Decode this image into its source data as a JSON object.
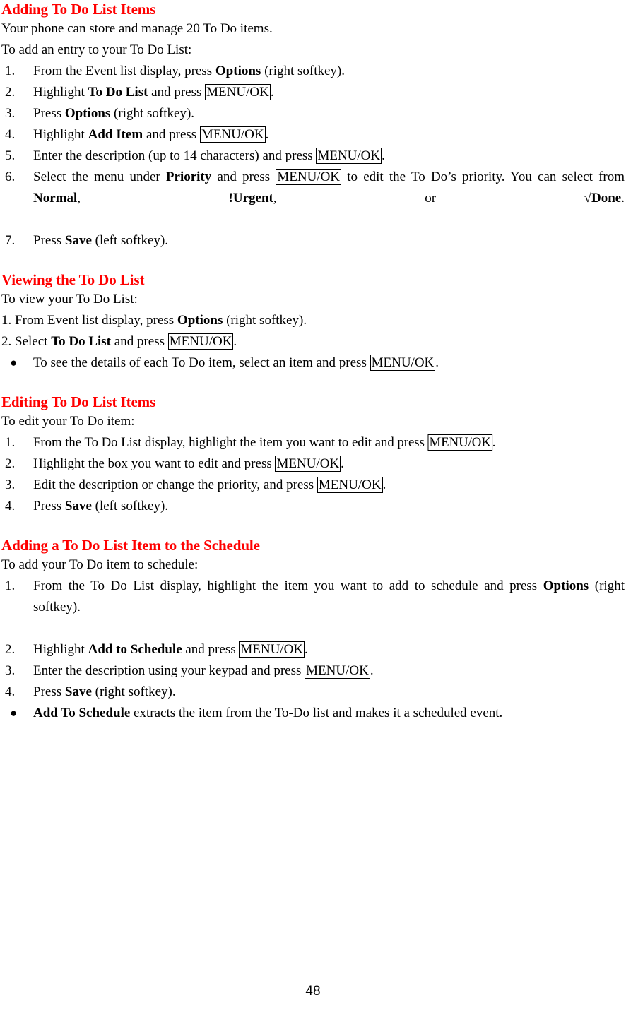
{
  "document": {
    "page_number": "48",
    "heading_color": "#ff0000",
    "text_color": "#000000"
  },
  "sections": [
    {
      "id": "adding",
      "heading": "Adding To Do List Items",
      "intro_1": "Your phone can store and manage 20 To Do items.",
      "intro_2": "To add an entry to your To Do List:",
      "steps": [
        {
          "num": "1.",
          "parts": [
            {
              "t": "From the Event list display, press ",
              "s": "plain"
            },
            {
              "t": "Options",
              "s": "bold"
            },
            {
              "t": " (right softkey).",
              "s": "plain"
            }
          ]
        },
        {
          "num": "2.",
          "parts": [
            {
              "t": "Highlight ",
              "s": "plain"
            },
            {
              "t": "To Do List",
              "s": "bold"
            },
            {
              "t": " and press ",
              "s": "plain"
            },
            {
              "t": "MENU/OK",
              "s": "key"
            },
            {
              "t": ".",
              "s": "plain"
            }
          ]
        },
        {
          "num": "3.",
          "parts": [
            {
              "t": "Press ",
              "s": "plain"
            },
            {
              "t": "Options",
              "s": "bold"
            },
            {
              "t": " (right softkey).",
              "s": "plain"
            }
          ]
        },
        {
          "num": "4.",
          "parts": [
            {
              "t": "Highlight ",
              "s": "plain"
            },
            {
              "t": "Add Item",
              "s": "bold"
            },
            {
              "t": " and press ",
              "s": "plain"
            },
            {
              "t": "MENU/OK",
              "s": "key"
            },
            {
              "t": ".",
              "s": "plain"
            }
          ]
        },
        {
          "num": "5.",
          "parts": [
            {
              "t": "Enter the description (up to 14 characters) and press ",
              "s": "plain"
            },
            {
              "t": "MENU/OK",
              "s": "key"
            },
            {
              "t": ".",
              "s": "plain"
            }
          ]
        },
        {
          "num": "6.",
          "justify": true,
          "parts": [
            {
              "t": "Select the menu under ",
              "s": "plain"
            },
            {
              "t": "Priority",
              "s": "bold"
            },
            {
              "t": " and press ",
              "s": "plain"
            },
            {
              "t": "MENU/OK",
              "s": "key"
            },
            {
              "t": " to edit the To Do’s priority. You can select from ",
              "s": "plain"
            },
            {
              "t": "Normal",
              "s": "bold"
            },
            {
              "t": ", ",
              "s": "plain"
            },
            {
              "t": "!Urgent",
              "s": "bold"
            },
            {
              "t": ", or ",
              "s": "plain"
            },
            {
              "t": "√Done",
              "s": "bold"
            },
            {
              "t": ".",
              "s": "plain"
            }
          ]
        },
        {
          "num": "7.",
          "parts": [
            {
              "t": "Press ",
              "s": "plain"
            },
            {
              "t": "Save",
              "s": "bold"
            },
            {
              "t": " (left softkey).",
              "s": "plain"
            }
          ]
        }
      ]
    },
    {
      "id": "viewing",
      "heading": "Viewing the To Do List",
      "intro_1": "To view your To Do List:",
      "plain_steps": [
        {
          "parts": [
            {
              "t": "1. From Event list display, press ",
              "s": "plain"
            },
            {
              "t": "Options",
              "s": "bold"
            },
            {
              "t": " (right softkey).",
              "s": "plain"
            }
          ]
        },
        {
          "parts": [
            {
              "t": "2. Select ",
              "s": "plain"
            },
            {
              "t": "To Do List",
              "s": "bold"
            },
            {
              "t": " and press ",
              "s": "plain"
            },
            {
              "t": "MENU/OK",
              "s": "key"
            },
            {
              "t": ".",
              "s": "plain"
            }
          ]
        }
      ],
      "bullets": [
        {
          "marker": "●",
          "parts": [
            {
              "t": "To see the details of each To Do item, select an item and press ",
              "s": "plain"
            },
            {
              "t": "MENU/OK",
              "s": "key"
            },
            {
              "t": ".",
              "s": "plain"
            }
          ]
        }
      ]
    },
    {
      "id": "editing",
      "heading": "Editing To Do List Items",
      "intro_1": "To edit your To Do item:",
      "steps": [
        {
          "num": "1.",
          "tight": true,
          "parts": [
            {
              "t": "From the To Do List display, highlight the item you want to edit and press ",
              "s": "plain"
            },
            {
              "t": "MENU/OK",
              "s": "key"
            },
            {
              "t": ".",
              "s": "plain"
            }
          ]
        },
        {
          "num": "2.",
          "parts": [
            {
              "t": "Highlight the box you want to edit and press ",
              "s": "plain"
            },
            {
              "t": "MENU/OK",
              "s": "key"
            },
            {
              "t": ".",
              "s": "plain"
            }
          ]
        },
        {
          "num": "3.",
          "parts": [
            {
              "t": "Edit the description or change the priority, and press ",
              "s": "plain"
            },
            {
              "t": "MENU/OK",
              "s": "key"
            },
            {
              "t": ".",
              "s": "plain"
            }
          ]
        },
        {
          "num": "4.",
          "parts": [
            {
              "t": "Press ",
              "s": "plain"
            },
            {
              "t": "Save",
              "s": "bold"
            },
            {
              "t": " (left softkey).",
              "s": "plain"
            }
          ]
        }
      ]
    },
    {
      "id": "schedule",
      "heading": "Adding a To Do List Item to the Schedule",
      "intro_1": "To add your To Do item to schedule:",
      "steps": [
        {
          "num": "1.",
          "justify": true,
          "parts": [
            {
              "t": "From the To Do List display, highlight the item you want to add to schedule and press ",
              "s": "plain"
            },
            {
              "t": "Options",
              "s": "bold"
            },
            {
              "t": " (right softkey).",
              "s": "plain"
            }
          ]
        },
        {
          "num": "2.",
          "parts": [
            {
              "t": "Highlight ",
              "s": "plain"
            },
            {
              "t": "Add to Schedule",
              "s": "bold"
            },
            {
              "t": " and press ",
              "s": "plain"
            },
            {
              "t": "MENU/OK",
              "s": "key"
            },
            {
              "t": ".",
              "s": "plain"
            }
          ]
        },
        {
          "num": "3.",
          "parts": [
            {
              "t": "Enter the description using your keypad and press ",
              "s": "plain"
            },
            {
              "t": "MENU/OK",
              "s": "key"
            },
            {
              "t": ".",
              "s": "plain"
            }
          ]
        },
        {
          "num": "4.",
          "parts": [
            {
              "t": "Press ",
              "s": "plain"
            },
            {
              "t": "Save",
              "s": "bold"
            },
            {
              "t": " (right softkey).",
              "s": "plain"
            }
          ]
        }
      ],
      "bullets": [
        {
          "marker": "●",
          "parts": [
            {
              "t": "Add To Schedule",
              "s": "bold"
            },
            {
              "t": " extracts the item from the To-Do list and makes it a scheduled event.",
              "s": "plain"
            }
          ]
        }
      ]
    }
  ]
}
